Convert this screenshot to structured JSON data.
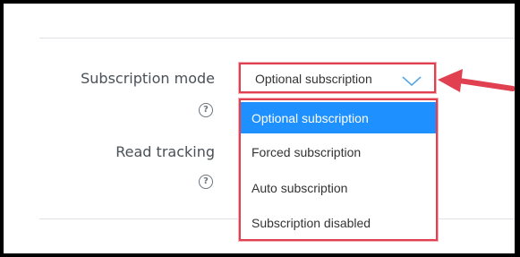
{
  "form": {
    "subscription_mode_label": "Subscription mode",
    "read_tracking_label": "Read tracking",
    "help_glyph": "?"
  },
  "select": {
    "current_value": "Optional subscription",
    "options": [
      {
        "label": "Optional subscription",
        "highlighted": true
      },
      {
        "label": "Forced subscription",
        "highlighted": false
      },
      {
        "label": "Auto subscription",
        "highlighted": false
      },
      {
        "label": "Subscription disabled",
        "highlighted": false
      }
    ]
  },
  "colors": {
    "highlight": "#e0404f",
    "selected_option_bg": "#1e90ff",
    "chevron": "#5aa9e6",
    "arrow": "#e0404f"
  },
  "icons": [
    "help-icon",
    "chevron-down-icon",
    "pointer-arrow-icon"
  ]
}
